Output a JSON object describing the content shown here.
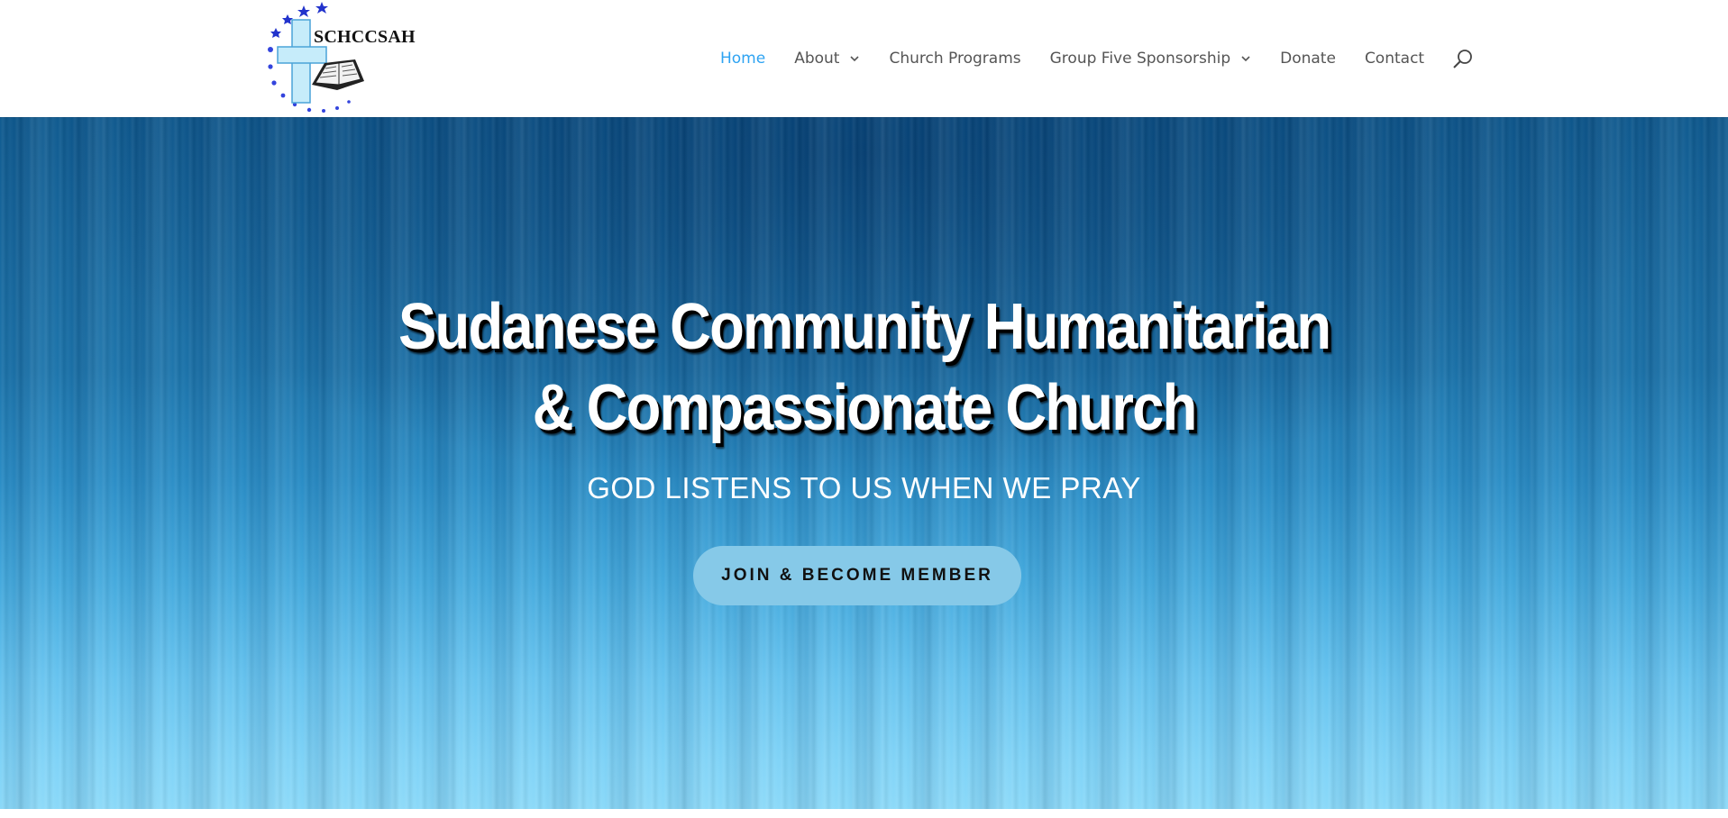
{
  "header": {
    "logo_text": "SCHCCSAH",
    "nav": [
      {
        "label": "Home",
        "active": true,
        "has_dropdown": false
      },
      {
        "label": "About",
        "active": false,
        "has_dropdown": true
      },
      {
        "label": "Church Programs",
        "active": false,
        "has_dropdown": false
      },
      {
        "label": "Group Five Sponsorship",
        "active": false,
        "has_dropdown": true
      },
      {
        "label": "Donate",
        "active": false,
        "has_dropdown": false
      },
      {
        "label": "Contact",
        "active": false,
        "has_dropdown": false
      }
    ],
    "search_icon": "search-icon"
  },
  "hero": {
    "title_line1": "Sudanese Community Humanitarian",
    "title_line2": "& Compassionate Church",
    "subtitle": "GOD LISTENS TO US WHEN WE PRAY",
    "cta_label": "JOIN & BECOME MEMBER"
  },
  "colors": {
    "nav_active": "#2ea3f2",
    "nav_text": "#555555",
    "cta_background": "#86c9e8",
    "hero_dark": "#0f5a8f",
    "hero_light": "#8cdaf9"
  }
}
